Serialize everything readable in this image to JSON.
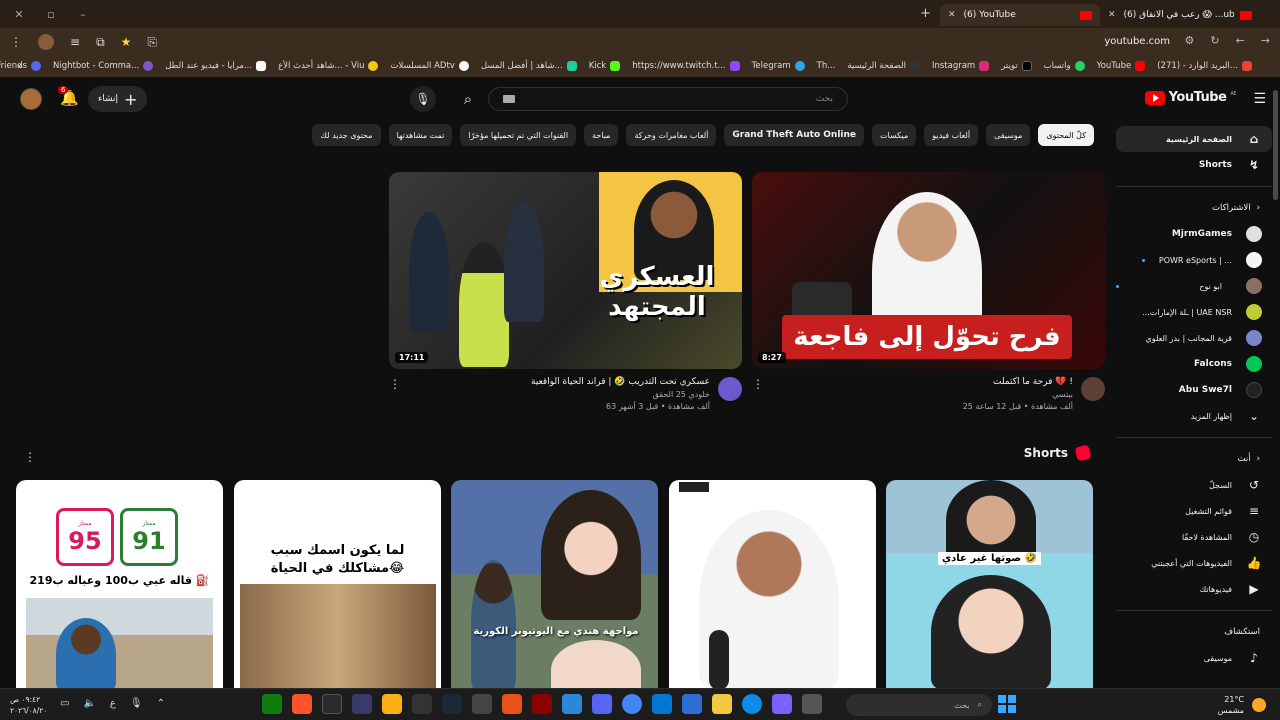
{
  "browser": {
    "tabs": [
      {
        "title": "(6) YouTube",
        "active": true
      },
      {
        "title": "(6) رعب في الأنفاق 😱 ...ube",
        "active": false
      }
    ],
    "url": "youtube.com",
    "bookmarks": [
      "البريد الوارد - (271)...",
      "YouTube",
      "واتساب",
      "تويتر",
      "Instagram",
      "الصفحة الرئيسية",
      "Th...",
      "Telegram",
      "https://www.twitch.t...",
      "Kick",
      "شاهد | أفضل المسل...",
      "المسلسلات ADtv",
      "شاهد أحدث الأع... - Viu",
      "مرايا - فيديو عند الطل...",
      "Nightbot - Comma...",
      "Discord | Friends"
    ]
  },
  "topbar": {
    "search_placeholder": "بحث",
    "create_label": "إنشاء",
    "notif_count": "6",
    "logo_text": "YouTube",
    "logo_region": "AE"
  },
  "chips": [
    "كلّ المحتوى",
    "موسيقى",
    "ألعاب فيديو",
    "ميكسات",
    "Grand Theft Auto Online",
    "ألعاب مغامرات وحركة",
    "مباحة",
    "القنوات التي تم تحميلها مؤخرًا",
    "تمت مشاهدتها",
    "محتوى جديد لك"
  ],
  "sidebar": {
    "main": [
      {
        "label": "الصفحة الرئيسية",
        "icon": "home-icon"
      },
      {
        "label": "Shorts",
        "icon": "shorts-icon"
      }
    ],
    "subs_header": "الاشتراكات",
    "subscriptions": [
      {
        "label": "MjrmGames",
        "color": "#e0e0e0"
      },
      {
        "label": "POWR eSports | ...",
        "color": "#e8e8e8"
      },
      {
        "label": "ابو نوح",
        "color": "#8d6e63"
      },
      {
        "label": "...ـلة الإمارات | UAE NSR",
        "color": "#c0ca33"
      },
      {
        "label": "قرية المجانب | بدر العلوي",
        "color": "#7986cb"
      },
      {
        "label": "Falcons",
        "color": "#00c853"
      },
      {
        "label": "Abu Swe7l",
        "color": "#222222"
      }
    ],
    "show_more": "إظهار المزيد",
    "you_header": "أنت",
    "you_items": [
      {
        "label": "السجلّ",
        "icon": "history-icon"
      },
      {
        "label": "قوائم التشغيل",
        "icon": "playlist-icon"
      },
      {
        "label": "المشاهدة لاحقًا",
        "icon": "clock-icon"
      },
      {
        "label": "الفيديوهات التي أعجبتني",
        "icon": "like-icon"
      },
      {
        "label": "فيديوهاتك",
        "icon": "video-icon"
      }
    ],
    "explore_header": "استكشاف",
    "explore_items": [
      {
        "label": "موسيقى",
        "icon": "music-icon"
      }
    ]
  },
  "videos": [
    {
      "title": "فرحة ما اكتملت 💔 !",
      "channel": "بيتسي",
      "stats": "25 ألف مشاهدة • قبل 12 ساعة",
      "duration": "8:27",
      "thumb_text": "فرح تحوّل إلى فاجعة"
    },
    {
      "title": "عسكري تحت التدريب 🤣 | قراند الحياة الواقعية",
      "channel": "خلودي 25 الحقق",
      "stats": "63 ألف مشاهدة • قبل 3 أشهر",
      "duration": "17:11",
      "thumb_text": "العسكري المجتهد"
    }
  ],
  "shorts": {
    "header": "Shorts",
    "items": [
      {
        "caption": "صوتها غير عادي 🤣"
      },
      {
        "caption": ""
      },
      {
        "caption": "مواجهة هندي مع اليوتيوبر الكورية"
      },
      {
        "caption": "لما يكون اسمك سبب مشاكلك في الحياة😂"
      },
      {
        "caption": "قاله عبي ب100 وعباله ب219 ⛽"
      }
    ],
    "pumps": [
      "91",
      "95"
    ],
    "pump_label": "ممتاز"
  },
  "taskbar": {
    "time": "٠٩:٤٢ ص",
    "date": "٢٠٢٦/٠٨/٢٠",
    "search_placeholder": "بحث",
    "weather_temp": "21°C",
    "weather_desc": "مشمس",
    "lang": "ع"
  }
}
